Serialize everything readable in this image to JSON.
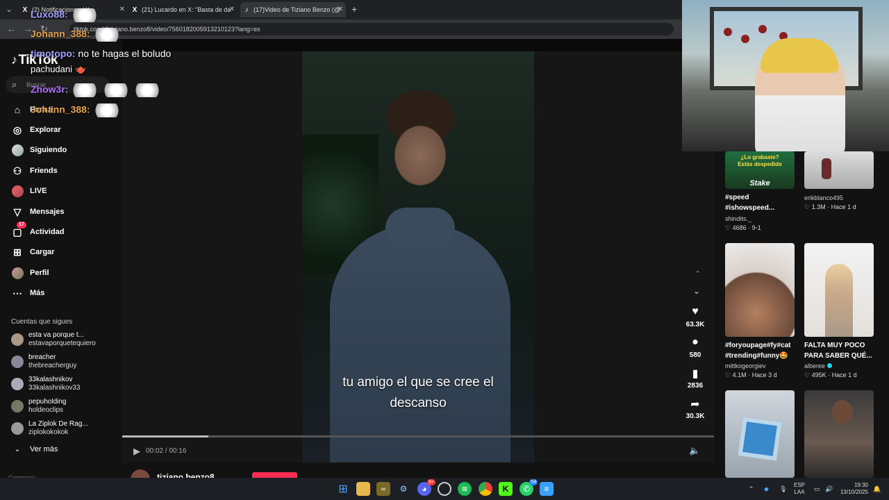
{
  "browser": {
    "tabs": [
      {
        "icon": "X",
        "label": "(2) Notificaciones / X"
      },
      {
        "icon": "X",
        "label": "(21) Lucardo en X: \"Basta de da"
      },
      {
        "icon": "♪",
        "label": "(17)Video de Tiziano Benzo (@"
      }
    ],
    "url": "tiktok.com/@tiziano.benzo8/video/7560182005913210123?lang=es"
  },
  "tiktok": {
    "logo": "TikTok",
    "search_placeholder": "Buscar",
    "nav": [
      {
        "icon": "home-icon",
        "label": "Para ti"
      },
      {
        "icon": "compass-icon",
        "label": "Explorar"
      },
      {
        "icon": "following-icon",
        "label": "Siguiendo"
      },
      {
        "icon": "friends-icon",
        "label": "Friends"
      },
      {
        "icon": "live-icon",
        "label": "LIVE"
      },
      {
        "icon": "message-icon",
        "label": "Mensajes"
      },
      {
        "icon": "activity-icon",
        "label": "Actividad",
        "badge": "17"
      },
      {
        "icon": "upload-icon",
        "label": "Cargar"
      },
      {
        "icon": "profile-icon",
        "label": "Perfil"
      },
      {
        "icon": "more-icon",
        "label": "Más"
      }
    ],
    "following_title": "Cuentas que sigues",
    "following": [
      {
        "name": "esta va porque t...",
        "handle": "estavaporquetequiero"
      },
      {
        "name": "breacher",
        "handle": "thebreacherguy"
      },
      {
        "name": "33kalashnikov",
        "handle": "33kalashnikov33"
      },
      {
        "name": "pepuholding",
        "handle": "holdeoclips"
      },
      {
        "name": "La Ziplok De Rag...",
        "handle": "ziplokokokok"
      }
    ],
    "see_more": "Ver más",
    "company": "Company"
  },
  "video": {
    "caption_line1": "tu amigo el que se cree el",
    "caption_line2": "descanso",
    "progress": 0.146,
    "time": "00:02 / 00:16",
    "author": "tiziano.benzo8",
    "actions": [
      {
        "icon": "heart-icon",
        "glyph": "♥",
        "count": "63.3K"
      },
      {
        "icon": "comment-icon",
        "glyph": "●",
        "count": "580"
      },
      {
        "icon": "bookmark-icon",
        "glyph": "▮",
        "count": "2836"
      },
      {
        "icon": "share-icon",
        "glyph": "➦",
        "count": "30.3K"
      }
    ]
  },
  "recommended": [
    {
      "title1": "#speed",
      "title2": "#ishowspeed...",
      "user": "shindits._",
      "likes": "4686",
      "date": "9-1",
      "thumb_text1": "¿Lo grabaste?",
      "thumb_text2": "Estás despedido",
      "thumb_brand": "Stake"
    },
    {
      "title1": "",
      "title2": "",
      "user": "erikblanco495",
      "likes": "1.3M",
      "date": "Hace 1 d"
    },
    {
      "title1": "#foryoupage#fy#cat",
      "title2": "#trending#funny🤩",
      "user": "mittkogeorgiev",
      "likes": "4.1M",
      "date": "Hace 3 d"
    },
    {
      "title1": "FALTA MUY POCO",
      "title2": "PARA SABER QUÉ...",
      "user": "alberee",
      "likes": "495K",
      "date": "Hace 1 d"
    },
    {
      "title1": "",
      "title2": "",
      "user": "",
      "likes": "",
      "date": ""
    },
    {
      "title1": "",
      "title2": "",
      "user": "",
      "likes": "",
      "date": ""
    }
  ],
  "chat": [
    {
      "user": "Luxo88:",
      "msg": "",
      "color": "#a0a0ff"
    },
    {
      "user": "Johann_388:",
      "msg": "",
      "color": "#e8a24a"
    },
    {
      "user": "timotopo:",
      "msg": " no te hagas el boludo",
      "color": "#a0a0ff"
    },
    {
      "user": "pachudani",
      "msg": "",
      "color": "#ffffff"
    },
    {
      "user": "Zhow3r:",
      "msg": "",
      "color": "#b070ff"
    },
    {
      "user": "Johann_388:",
      "msg": "",
      "color": "#e8a24a"
    }
  ],
  "taskbar": {
    "lang1": "ESP",
    "lang2": "LAA",
    "time": "19:30",
    "date": "13/10/2025",
    "discord_badge": "9+",
    "whatsapp_badge": "54"
  },
  "colors": {
    "accent": "#fe2c55",
    "bg": "#121212"
  }
}
